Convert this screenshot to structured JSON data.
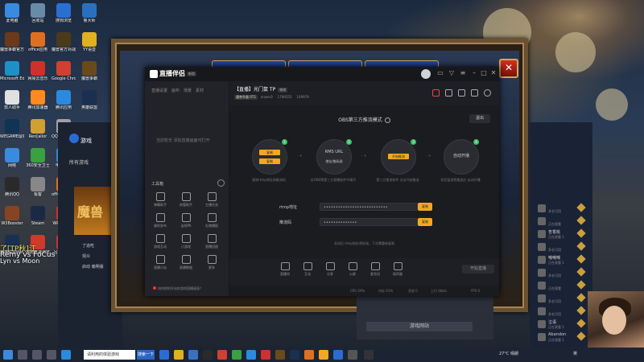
{
  "desktop": {
    "icons": [
      {
        "label": "此电脑",
        "color": "#3a8ae0"
      },
      {
        "label": "魔兽争霸官方对战平台",
        "color": "#6a3a1a"
      },
      {
        "label": "Microsoft Edge",
        "color": "#1e90c8"
      },
      {
        "label": "双人助手",
        "color": "#e0e0e0"
      },
      {
        "label": "WEGAME鼠标设置",
        "color": "#113355"
      },
      {
        "label": "网络",
        "color": "#3a8ae0"
      },
      {
        "label": "腾讯QQ",
        "color": "#2a2a2a"
      },
      {
        "label": "W3Booster",
        "color": "#884422"
      },
      {
        "label": "英雄联盟WeGame版",
        "color": "#1a3050"
      },
      {
        "label": "回收站",
        "color": "#6a8aaa"
      },
      {
        "label": "office应用",
        "color": "#e07020"
      },
      {
        "label": "网易云音乐",
        "color": "#d0302a"
      },
      {
        "label": "腾讯加速器",
        "color": "#ff8a20"
      },
      {
        "label": "Ren[ailor",
        "color": "#d0a030"
      },
      {
        "label": "360安全卫士",
        "color": "#3aa040"
      },
      {
        "label": "极客",
        "color": "#888888"
      },
      {
        "label": "Steam",
        "color": "#1a2a44"
      },
      {
        "label": "搜狗高速浏览器",
        "color": "#d03a2a"
      },
      {
        "label": "搜狗浏览",
        "color": "#2a70d0"
      },
      {
        "label": "魔兽官方对战平台",
        "color": "#4a3a1a"
      },
      {
        "label": "Google Chrome",
        "color": "#d04030"
      },
      {
        "label": "腾讯应用",
        "color": "#2a8ae0"
      },
      {
        "label": "QQ图片 20218504",
        "color": "#a0a0a0"
      },
      {
        "label": "电脑管家",
        "color": "#2a8ad0"
      },
      {
        "label": "office应用工具",
        "color": "#e07020"
      },
      {
        "label": "WPS Office",
        "color": "#d03030"
      },
      {
        "label": "吕布中文站",
        "color": "#d03030"
      },
      {
        "label": "鲁大师",
        "color": "#2a70c0"
      },
      {
        "label": "YY语音",
        "color": "#e0b020"
      },
      {
        "label": "魔兽争霸",
        "color": "#6a4a1a"
      },
      {
        "label": "英雄联盟",
        "color": "#1a3050"
      }
    ],
    "overlay_text_1": "了[TP秋]江",
    "overlay_text_2": "Remy vs FoCus",
    "overlay_text_3": "Lyn vs Moon",
    "overlay_text_4": "了追吃",
    "overlay_text_5": "观众",
    "overlay_text_6": "启动 偏明版"
  },
  "left_game_app": {
    "title": "游戏",
    "nav_item": "所有游戏",
    "game_art_text": "魔兽"
  },
  "right_list": [
    {
      "name": "",
      "status": "多名可用"
    },
    {
      "name": "",
      "status": "正在观看"
    },
    {
      "name": "杏香桃",
      "status": "正在观看 1"
    },
    {
      "name": "",
      "status": "多名可用"
    },
    {
      "name": "嘲嘲嘲",
      "status": "正在观看 1"
    },
    {
      "name": "",
      "status": "多名可用"
    },
    {
      "name": "",
      "status": "正在观看"
    },
    {
      "name": "",
      "status": "多名可用"
    },
    {
      "name": "",
      "status": "多名可用"
    },
    {
      "name": "泣语",
      "status": "正在观看 1"
    },
    {
      "name": "Abandon",
      "status": "正在观看 1"
    }
  ],
  "middark": {
    "button": "游戏网站"
  },
  "app": {
    "brand": "直播伴侣",
    "version": "新版",
    "left_tabs": [
      "直播设置",
      "画布",
      "场景",
      "素材"
    ],
    "empty_text": "当前暂无 添加直播画面可打开",
    "tools_title": "工具箱",
    "tools": [
      "弹幕助手",
      "房管助手",
      "主播任务",
      "福利发布",
      "连线PK",
      "礼物播报",
      "游戏互动",
      "小游戏",
      "直播回放",
      "直播小店",
      "直播数据",
      "更多"
    ],
    "notice": "如何把把开启的游戏直播画面？",
    "room_title": "【直播】光门鼠 TP",
    "room_edit": "修改",
    "room_category": "魔兽争霸 RTS",
    "room_meta_1": "anwer0",
    "room_meta_2": "1799555",
    "room_meta_3": "149979",
    "mode_title": "OBS第三方推流模式",
    "exit_label": "退出",
    "steps": [
      {
        "num": "1",
        "line1": "",
        "line2": "",
        "desc": "复制rtmp地址和推流码",
        "btn1": "复制",
        "btn2": "复制"
      },
      {
        "num": "2",
        "line1": "RMS URL",
        "line2": "地址/推码说",
        "desc": "在OBS等第三方直播软件中填写",
        "btn1": "",
        "btn2": ""
      },
      {
        "num": "3",
        "line1": "",
        "line2": "",
        "desc": "第三方推流软件 点击开始推流",
        "btn1": "开始推流",
        "btn2": ""
      },
      {
        "num": "4",
        "line1": "自动开播",
        "line2": "",
        "desc": "伴侣监测到推流后 自动开播",
        "btn1": "",
        "btn2": ""
      }
    ],
    "rtmp_label": "rtmp地址",
    "rtmp_value": "•••••••••••••••••••••••••••",
    "key_label": "推流码",
    "key_value": "••••••••••••••",
    "copy_label": "复制",
    "hint": "关闭后 rtmp地址将失效，下次需重新复制",
    "toolbar": [
      "直播间",
      "互动",
      "分享",
      "公屏",
      "麦克风",
      "扬声器"
    ],
    "start_label": "开始直播",
    "status": [
      "CPU 29%",
      "内存 61%",
      "丢帧 0",
      "上行 0kb/s",
      "FPS 0"
    ]
  },
  "taskbar": {
    "search_placeholder": "请利用的体验游戏",
    "search_btn": "搜索一下",
    "weather": "27°C 晴朗",
    "time": "",
    "lang": "英"
  }
}
